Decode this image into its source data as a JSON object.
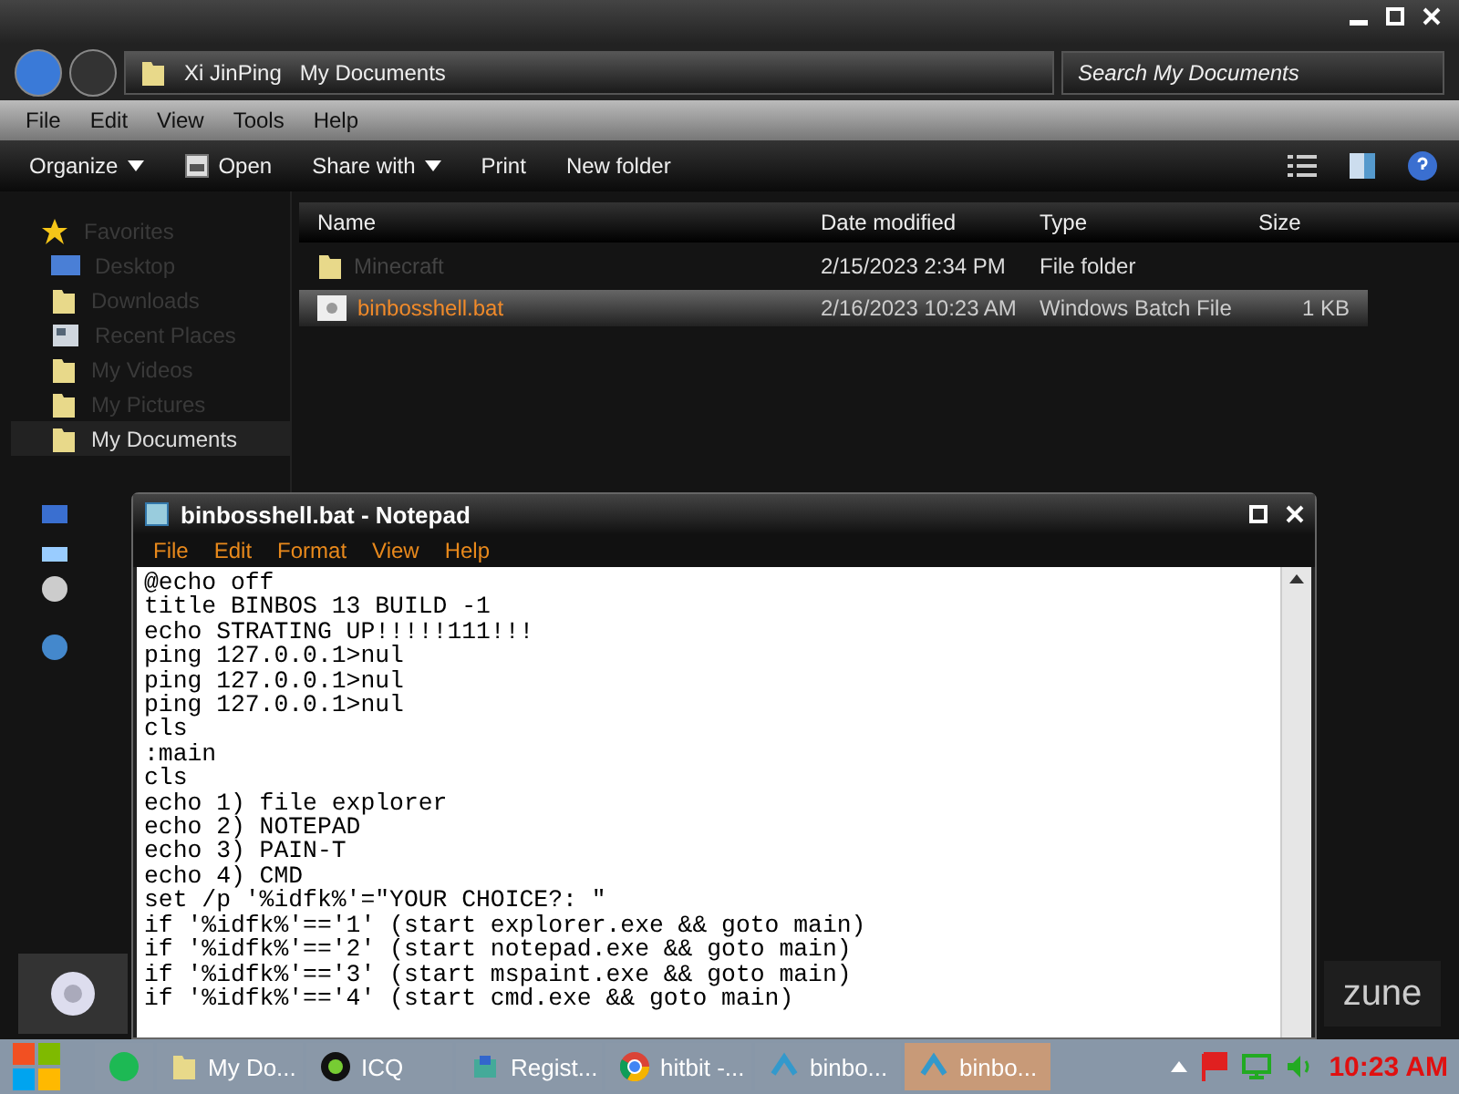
{
  "explorer": {
    "breadcrumb": [
      "Xi JinPing",
      "My Documents"
    ],
    "search": {
      "placeholder": "Search My Documents"
    },
    "menu": [
      "File",
      "Edit",
      "View",
      "Tools",
      "Help"
    ],
    "toolbar": [
      {
        "label": "Organize",
        "kind": "dropdown"
      },
      {
        "label": "Open",
        "kind": "icon"
      },
      {
        "label": "Share with",
        "kind": "dropdown"
      },
      {
        "label": "Print",
        "kind": "plain"
      },
      {
        "label": "New folder",
        "kind": "plain"
      }
    ],
    "sidebar": {
      "items": [
        {
          "label": "Favorites",
          "kind": "star",
          "selected": false
        },
        {
          "label": "Desktop",
          "kind": "desktop",
          "selected": false
        },
        {
          "label": "Downloads",
          "kind": "folder",
          "selected": false
        },
        {
          "label": "Recent Places",
          "kind": "recent",
          "selected": false
        },
        {
          "label": "My Videos",
          "kind": "folder",
          "selected": false
        },
        {
          "label": "My Pictures",
          "kind": "folder",
          "selected": false
        },
        {
          "label": "My Documents",
          "kind": "folder",
          "selected": true
        }
      ]
    },
    "table": {
      "columns": [
        "Name",
        "Date modified",
        "Type",
        "Size"
      ],
      "rows": [
        {
          "kind": "folder",
          "name": "Minecraft",
          "date": "2/15/2023 2:34 PM",
          "type": "File folder",
          "selected": false
        },
        {
          "kind": "file",
          "name": "binbosshell.bat",
          "date": "2/16/2023 10:23 AM",
          "type": "Windows Batch File",
          "size": "1 KB",
          "selected": true
        }
      ]
    },
    "zune_logo": "zune"
  },
  "notepad": {
    "title": "binbosshell.bat - Notepad",
    "menu": [
      "File",
      "Edit",
      "Format",
      "View",
      "Help"
    ],
    "lines": [
      "@echo off",
      "title BINBOS 13 BUILD -1",
      "echo STRATING UP!!!!!111!!!",
      "ping 127.0.0.1>nul",
      "ping 127.0.0.1>nul",
      "ping 127.0.0.1>nul",
      "cls",
      ":main",
      "cls",
      "echo 1) file explorer",
      "echo 2) NOTEPAD",
      "echo 3) PAIN-T",
      "echo 4) CMD",
      "set /p '%idfk%'=\"YOUR CHOICE?: \"",
      "if '%idfk%'=='1' (start explorer.exe && goto main)",
      "if '%idfk%'=='2' (start notepad.exe && goto main)",
      "if '%idfk%'=='3' (start mspaint.exe && goto main)",
      "if '%idfk%'=='4' (start cmd.exe && goto main)"
    ]
  },
  "taskbar": {
    "items": [
      {
        "kind": "spotify",
        "selected": false
      },
      {
        "kind": "folder",
        "label": "My Do...",
        "selected": false
      },
      {
        "kind": "icq",
        "label": "ICQ",
        "selected": false
      },
      {
        "kind": "registry",
        "label": "Regist...",
        "selected": false
      },
      {
        "kind": "chrome",
        "label": "hitbit -...",
        "selected": false
      },
      {
        "kind": "notepad",
        "label": "binbo...",
        "selected": false
      },
      {
        "kind": "notepad",
        "label": "binbo...",
        "selected": true
      }
    ],
    "clock": "10:23 AM"
  }
}
